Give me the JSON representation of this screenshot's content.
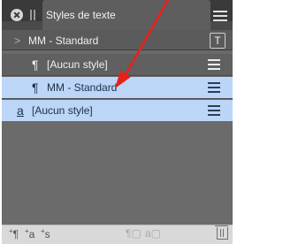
{
  "panel": {
    "tab_title": "Styles de texte"
  },
  "header": {
    "chevron": ">",
    "current_style": "MM - Standard",
    "apply_icon": "T"
  },
  "styles": [
    {
      "symbol": "¶",
      "name": "[Aucun style]",
      "type": "paragraph",
      "selected": false
    },
    {
      "symbol": "¶",
      "name": "MM - Standard",
      "type": "paragraph",
      "selected": true
    },
    {
      "symbol": "a",
      "name": "[Aucun style]",
      "type": "character",
      "selected": false
    }
  ],
  "footer": {
    "new_paragraph_style": "¶",
    "new_character_style": "a",
    "new_group": "s",
    "plus": "+"
  },
  "colors": {
    "selected_row": "#bcd6f8",
    "annotation_arrow": "#e8211b"
  },
  "icons": [
    "close-icon",
    "grip-icon",
    "panel-menu-icon",
    "apply-style-icon",
    "paragraph-icon",
    "character-icon",
    "row-menu-icon",
    "delete-icon"
  ]
}
